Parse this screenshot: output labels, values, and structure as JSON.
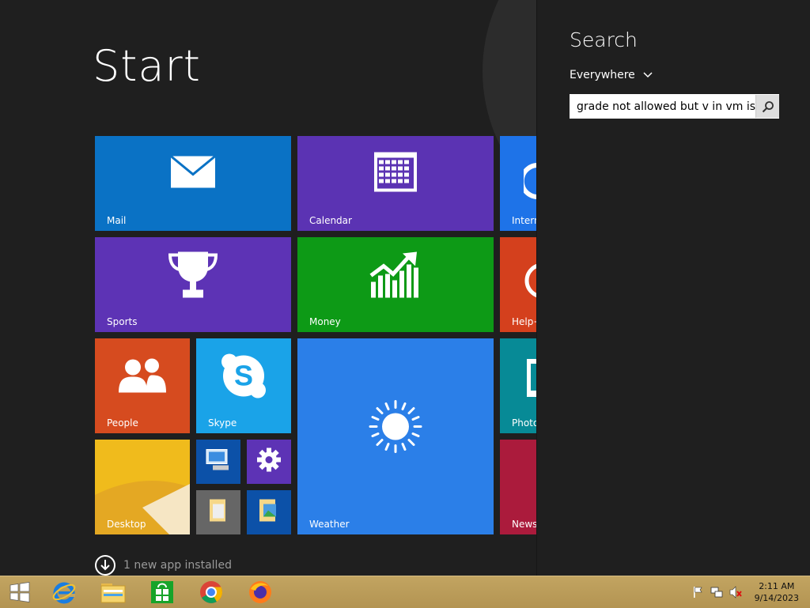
{
  "start": {
    "title": "Start",
    "notice": "1 new app installed"
  },
  "tiles": {
    "mail": "Mail",
    "calendar": "Calendar",
    "internet": "Intern",
    "sports": "Sports",
    "money": "Money",
    "help": "Help+",
    "people": "People",
    "skype": "Skype",
    "weather": "Weather",
    "photos": "Photo",
    "desktop": "Desktop",
    "news": "News"
  },
  "search": {
    "title": "Search",
    "scope": "Everywhere",
    "query": "grade not allowed but v in vm is)"
  },
  "taskbar": {
    "time": "2:11 AM",
    "date": "9/14/2023"
  },
  "colors": {
    "mail": "#0a72c5",
    "calendar": "#5b33b3",
    "internet": "#1e73e8",
    "sports": "#5d33b5",
    "money": "#0d9a16",
    "help": "#d4401d",
    "people": "#d64b1f",
    "skype": "#1aa3e8",
    "weather": "#2b7fe8",
    "photos": "#078a96",
    "desktop": "#e4a823",
    "news": "#ab1b3c",
    "taskbar": "#bc9d59"
  }
}
